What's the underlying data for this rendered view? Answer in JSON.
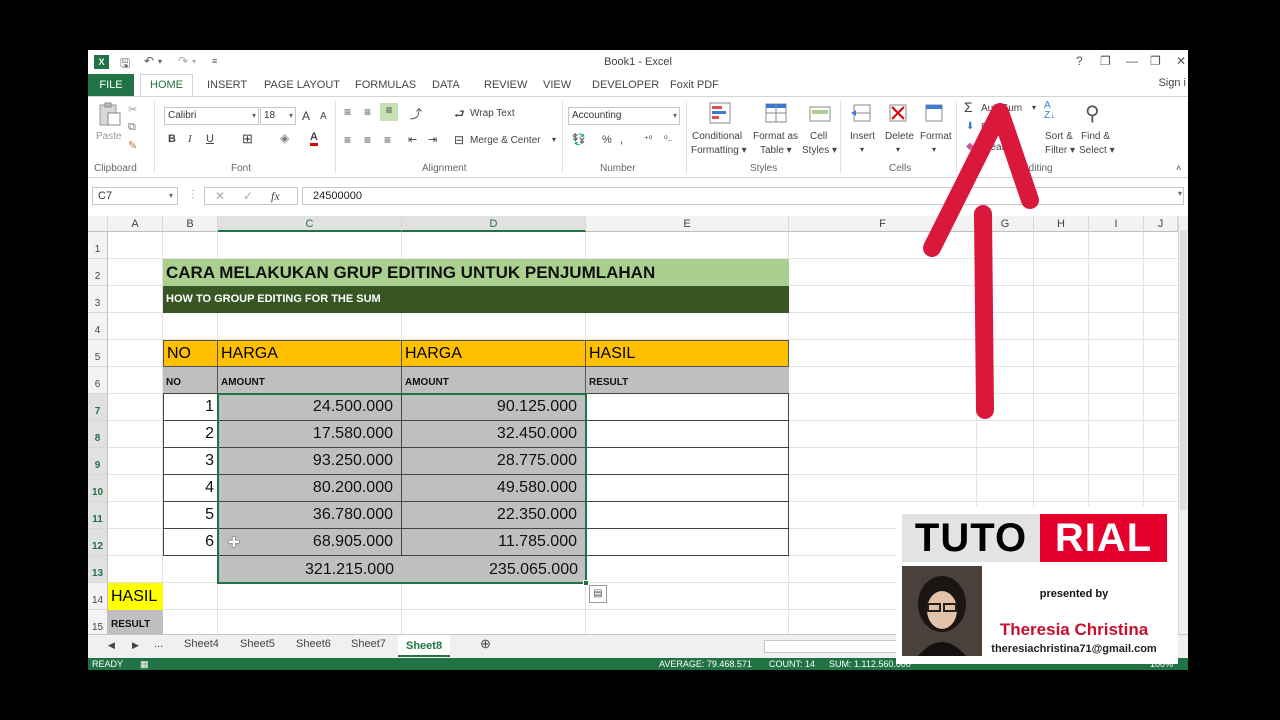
{
  "window": {
    "title": "Book1 - Excel",
    "help": "?",
    "min": "—",
    "restore": "❐",
    "close": "✕"
  },
  "tabs": {
    "file": "FILE",
    "items": [
      "HOME",
      "INSERT",
      "PAGE LAYOUT",
      "FORMULAS",
      "DATA",
      "REVIEW",
      "VIEW",
      "DEVELOPER",
      "Foxit PDF"
    ],
    "active": "HOME",
    "sign_in": "Sign i"
  },
  "ribbon": {
    "clipboard": {
      "label": "Clipboard",
      "paste": "Paste"
    },
    "font": {
      "label": "Font",
      "name": "Calibri",
      "size": "18",
      "grow": "A",
      "shrink": "A",
      "bold": "B",
      "italic": "I",
      "underline": "U",
      "font_color": "A"
    },
    "alignment": {
      "label": "Alignment",
      "wrap": "Wrap Text",
      "merge": "Merge & Center"
    },
    "number": {
      "label": "Number",
      "format": "Accounting",
      "percent": "%"
    },
    "styles": {
      "label": "Styles",
      "conditional": [
        "Conditional",
        "Formatting"
      ],
      "format_table": [
        "Format as",
        "Table"
      ],
      "cell_styles": [
        "Cell",
        "Styles"
      ]
    },
    "cells": {
      "label": "Cells",
      "insert": "Insert",
      "delete": "Delete",
      "format": "Format"
    },
    "editing": {
      "label": "Editing",
      "autosum": "AutoSum",
      "fill": "Fill",
      "clear": "Clear",
      "sort": [
        "Sort &",
        "Filter"
      ],
      "find": [
        "Find &",
        "Select"
      ]
    }
  },
  "formula_bar": {
    "name_box": "C7",
    "fx": "fx",
    "value": "24500000"
  },
  "columns": [
    "A",
    "B",
    "C",
    "D",
    "E",
    "F",
    "G",
    "H",
    "I",
    "J"
  ],
  "rows": [
    "1",
    "2",
    "3",
    "4",
    "5",
    "6",
    "7",
    "8",
    "9",
    "10",
    "11",
    "12",
    "13",
    "14",
    "15"
  ],
  "sheet": {
    "title": "CARA MELAKUKAN GRUP EDITING UNTUK PENJUMLAHAN",
    "subtitle": "HOW TO GROUP EDITING FOR THE SUM",
    "headers": [
      "NO",
      "HARGA",
      "HARGA",
      "HASIL"
    ],
    "subheaders": [
      "NO",
      "AMOUNT",
      "AMOUNT",
      "RESULT"
    ],
    "data": [
      {
        "no": "1",
        "c": "24.500.000",
        "d": "90.125.000"
      },
      {
        "no": "2",
        "c": "17.580.000",
        "d": "32.450.000"
      },
      {
        "no": "3",
        "c": "93.250.000",
        "d": "28.775.000"
      },
      {
        "no": "4",
        "c": "80.200.000",
        "d": "49.580.000"
      },
      {
        "no": "5",
        "c": "36.780.000",
        "d": "22.350.000"
      },
      {
        "no": "6",
        "c": "68.905.000",
        "d": "11.785.000"
      }
    ],
    "totals": {
      "c": "321.215.000",
      "d": "235.065.000"
    },
    "hasil": "HASIL",
    "result": "RESULT"
  },
  "sheet_tabs": [
    "...",
    "Sheet4",
    "Sheet5",
    "Sheet6",
    "Sheet7",
    "Sheet8"
  ],
  "active_sheet": "Sheet8",
  "status": {
    "ready": "READY",
    "average": "AVERAGE: 79.468.571",
    "count": "COUNT: 14",
    "sum": "SUM: 1.112.560.000",
    "zoom": "100%"
  },
  "overlay": {
    "tuto": "TUTO",
    "rial": "RIAL",
    "presented": "presented by",
    "name": "Theresia Christina",
    "email": "theresiachristina71@gmail.com"
  },
  "colors": {
    "excel_green": "#217346",
    "title_band": "#a9d08e",
    "subtitle_band": "#375623",
    "header_orange": "#ffc000",
    "subheader_gray": "#bfbfbf",
    "hasil_yellow": "#ffff00",
    "arrow_red": "#d9183b"
  }
}
